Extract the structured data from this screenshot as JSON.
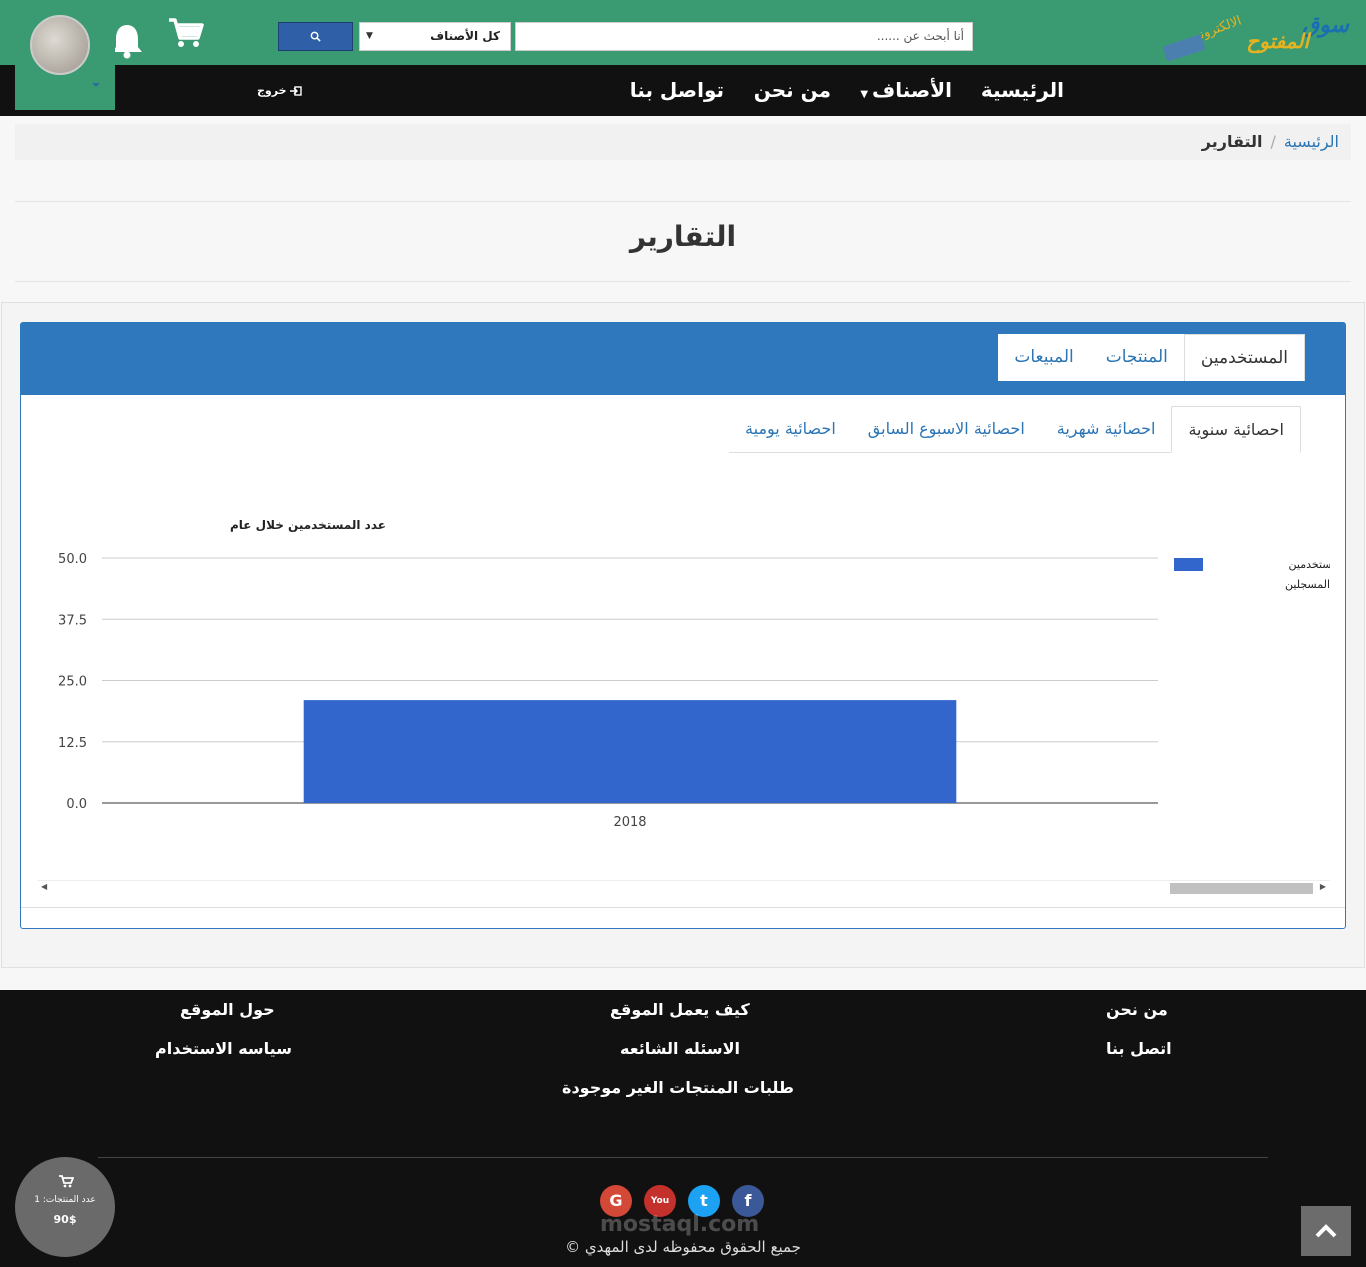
{
  "header": {
    "logo_text": "سوق المفتوح الالكتروني",
    "search_placeholder": "أنا أبحث عن ......",
    "category_select": "كل الأصناف",
    "search_button_icon": "search-icon",
    "cart_icon": "cart-icon",
    "notifications_icon": "bell-icon",
    "user_avatar": "avatar"
  },
  "nav": {
    "home": "الرئيسية",
    "categories": "الأصناف",
    "about": "من نحن",
    "contact": "تواصل بنا",
    "logout": "خروج"
  },
  "breadcrumb": {
    "home": "الرئيسية",
    "separator": "/",
    "current": "التقارير"
  },
  "page_title": "التقارير",
  "tabs_main": [
    {
      "label": "المستخدمين",
      "active": true
    },
    {
      "label": "المنتجات",
      "active": false
    },
    {
      "label": "المبيعات",
      "active": false
    }
  ],
  "tabs_sub": [
    {
      "label": "احصائية سنوية",
      "active": true
    },
    {
      "label": "احصائية شهرية",
      "active": false
    },
    {
      "label": "احصائية الاسبوع السابق",
      "active": false
    },
    {
      "label": "احصائية يومية",
      "active": false
    }
  ],
  "chart_data": {
    "type": "bar",
    "title": "عدد المستخدمين خلال عام",
    "categories": [
      "2018"
    ],
    "series": [
      {
        "name": "عدد المستخدمين المسجلين",
        "values": [
          21
        ],
        "color": "#3366cc"
      }
    ],
    "yticks": [
      "0.0",
      "12.5",
      "25.0",
      "37.5",
      "50.0"
    ],
    "ylim": [
      0,
      50
    ],
    "grid": true,
    "legend": "right"
  },
  "footer": {
    "about_us": "من نحن",
    "contact_us": "اتصل بنا",
    "how_it_works": "كيف يعمل الموقع",
    "faq": "الاسئله الشائعه",
    "missing_requests": "طلبات المنتجات الغير موجودة",
    "about_site": "حول الموقع",
    "usage_policy": "سياسه الاستخدام",
    "social": [
      "google",
      "youtube",
      "twitter",
      "facebook"
    ],
    "google_label": "G",
    "youtube_label": "You",
    "twitter_label": "t",
    "facebook_label": "f",
    "copyright": "جميع الحقوق محفوظه لدى المهدي ©",
    "watermark": "mostaql.com"
  },
  "cart_summary": {
    "count_label": "عدد المنتجات: 1",
    "total": "90$"
  },
  "colors": {
    "header_green": "#3a9b73",
    "nav_black": "#111111",
    "panel_blue": "#2f78bd",
    "bar_blue": "#3366cc"
  }
}
